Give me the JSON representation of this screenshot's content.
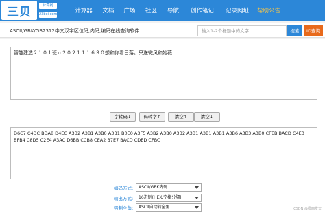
{
  "logo": {
    "text": "三贝",
    "sub_top": "计算网",
    "sub_bottom": "23bei.com"
  },
  "nav": {
    "items": [
      {
        "label": "计算器",
        "highlight": false
      },
      {
        "label": "文档",
        "highlight": false
      },
      {
        "label": "广场",
        "highlight": false
      },
      {
        "label": "社区",
        "highlight": false
      },
      {
        "label": "导航",
        "highlight": false
      },
      {
        "label": "创作笔记",
        "highlight": false
      },
      {
        "label": "记录网址",
        "highlight": false
      },
      {
        "label": "帮助公告",
        "highlight": true
      }
    ]
  },
  "header": {
    "title": "ASCII/GBK/GB2312中文汉字区位码,内码,编码在线查询软件",
    "search_placeholder": "输入1-2个标题中的文字",
    "search_button": "搜索",
    "id_button": "ID查询"
  },
  "input_text": "智能建造２１０１班ｕ２０２１１１６３０想和你看日落。只送微风和她薇",
  "buttons": {
    "to_code": "字转码↓",
    "to_char": "码转字↑",
    "clear_top": "清空↑",
    "clear_bottom": "清空↓"
  },
  "output_text": "D6C7 C4DC BDA8 D4EC A3B2 A3B1 A3B0 A3B1 B0E0 A3F5 A3B2 A3B0 A3B2 A3B1 A3B1 A3B1 A3B6 A3B3 A3B0 CFEB BACD C4E3 BFB4 C8D5 C2E4 A3AC D6BB CCB8 CEA2 B7E7 BACD CDED CFBC",
  "options": {
    "encoding_label": "编码方式:",
    "encoding_value": "ASCII/GBK内码",
    "output_label": "输出方式:",
    "output_value": "16进制(HEX,空格分隔)",
    "fullwidth_label": "强制全角:",
    "fullwidth_value": "ASCII自动转全角"
  },
  "watermark": "CSDN @卿四发文",
  "colors": {
    "brand": "#2c87d8",
    "highlight": "#f6c54a",
    "id_button": "#e86a1c"
  }
}
